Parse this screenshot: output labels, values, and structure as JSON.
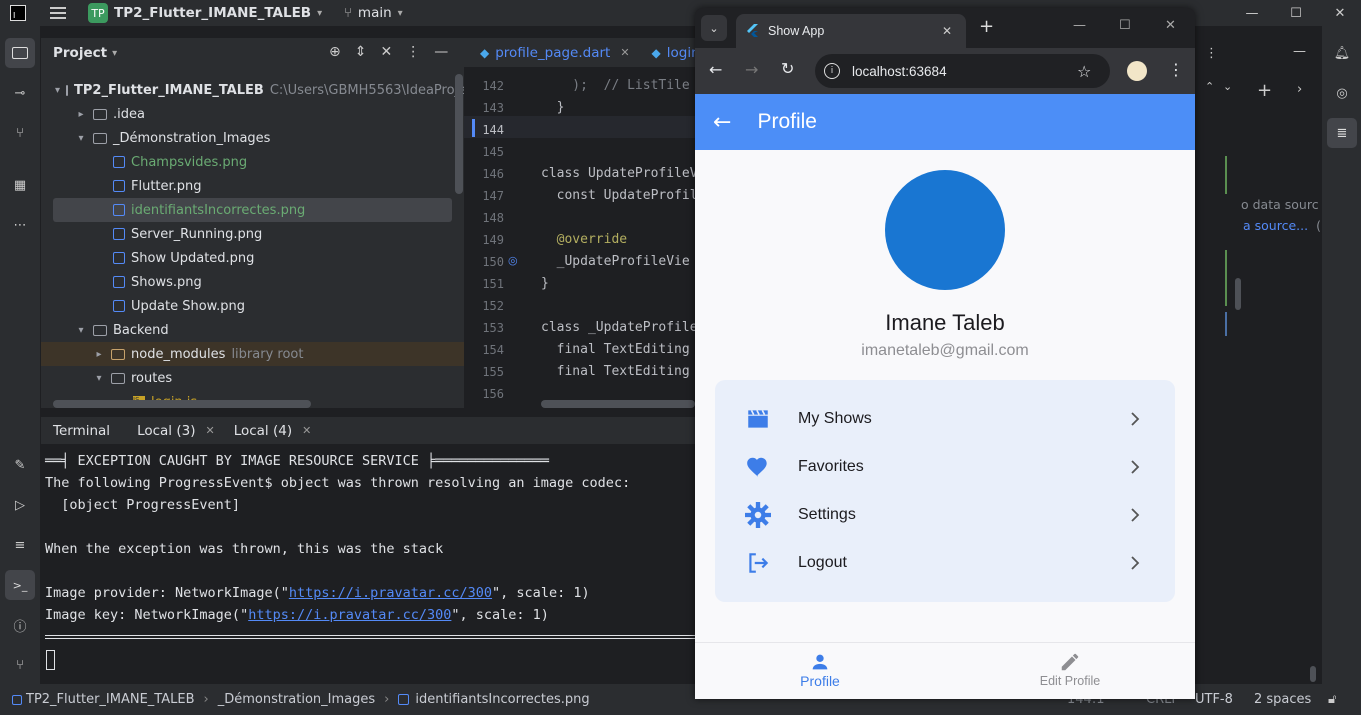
{
  "titlebar": {
    "project_badge": "TP",
    "project_name": "TP2_Flutter_IMANE_TALEB",
    "branch": "main"
  },
  "project_panel": {
    "title": "Project",
    "root_name": "TP2_Flutter_IMANE_TALEB",
    "root_path": "C:\\Users\\GBMH5563\\IdeaProject",
    "items": [
      {
        "label": ".idea"
      },
      {
        "label": "_Démonstration_Images"
      },
      {
        "label": "Champsvides.png"
      },
      {
        "label": "Flutter.png"
      },
      {
        "label": "identifiantsIncorrectes.png"
      },
      {
        "label": "Server_Running.png"
      },
      {
        "label": "Show Updated.png"
      },
      {
        "label": "Shows.png"
      },
      {
        "label": "Update Show.png"
      },
      {
        "label": "Backend"
      },
      {
        "label": "node_modules",
        "hint": "library root"
      },
      {
        "label": "routes"
      },
      {
        "label": "login.js"
      }
    ]
  },
  "editor": {
    "tabs": [
      {
        "label": "profile_page.dart"
      },
      {
        "label": "login"
      }
    ],
    "lines": [
      {
        "n": "142",
        "code": "    );  // ListTile"
      },
      {
        "n": "143",
        "code": "  }"
      },
      {
        "n": "144",
        "code": ""
      },
      {
        "n": "145",
        "code": ""
      },
      {
        "n": "146",
        "code": "class UpdateProfileV"
      },
      {
        "n": "147",
        "code": "  const UpdateProfil"
      },
      {
        "n": "148",
        "code": ""
      },
      {
        "n": "149",
        "code": "  @override"
      },
      {
        "n": "150",
        "code": "  _UpdateProfileVie"
      },
      {
        "n": "151",
        "code": "}"
      },
      {
        "n": "152",
        "code": ""
      },
      {
        "n": "153",
        "code": "class _UpdateProfile"
      },
      {
        "n": "154",
        "code": "  final TextEditing"
      },
      {
        "n": "155",
        "code": "  final TextEditing"
      },
      {
        "n": "156",
        "code": ""
      }
    ]
  },
  "right_panel": {
    "line1": "o data sourc",
    "line2": "a source...",
    "line2b": "("
  },
  "terminal": {
    "tabs": [
      {
        "label": "Terminal"
      },
      {
        "label": "Local (3)"
      },
      {
        "label": "Local (4)"
      }
    ],
    "line1": "══╡ EXCEPTION CAUGHT BY IMAGE RESOURCE SERVICE ╞══════════════",
    "line2": "The following ProgressEvent$ object was thrown resolving an image codec:",
    "line3": "  [object ProgressEvent]",
    "line4": "When the exception was thrown, this was the stack",
    "line5_pre": "Image provider: NetworkImage(\"",
    "line5_link": "https://i.pravatar.cc/300",
    "line5_post": "\", scale: 1)",
    "line6_pre": "Image key: NetworkImage(\"",
    "line6_link": "https://i.pravatar.cc/300",
    "line6_post": "\", scale: 1)"
  },
  "browser": {
    "tab_title": "Show App",
    "url": "localhost:63684"
  },
  "app": {
    "title": "Profile",
    "user_name": "Imane Taleb",
    "user_email": "imanetaleb@gmail.com",
    "menu": [
      {
        "label": "My Shows",
        "icon": "movie-icon"
      },
      {
        "label": "Favorites",
        "icon": "heart-icon"
      },
      {
        "label": "Settings",
        "icon": "gear-icon"
      },
      {
        "label": "Logout",
        "icon": "logout-icon"
      }
    ],
    "bottom_nav": [
      {
        "label": "Profile"
      },
      {
        "label": "Edit Profile"
      }
    ],
    "accent": "#4c8ef7",
    "avatar_color": "#1976d2"
  },
  "statusbar": {
    "crumbs": [
      "TP2_Flutter_IMANE_TALEB",
      "_Démonstration_Images",
      "identifiantsIncorrectes.png"
    ],
    "position": "144:1",
    "line_sep": "CRLF",
    "encoding": "UTF-8",
    "indent": "2 spaces"
  }
}
